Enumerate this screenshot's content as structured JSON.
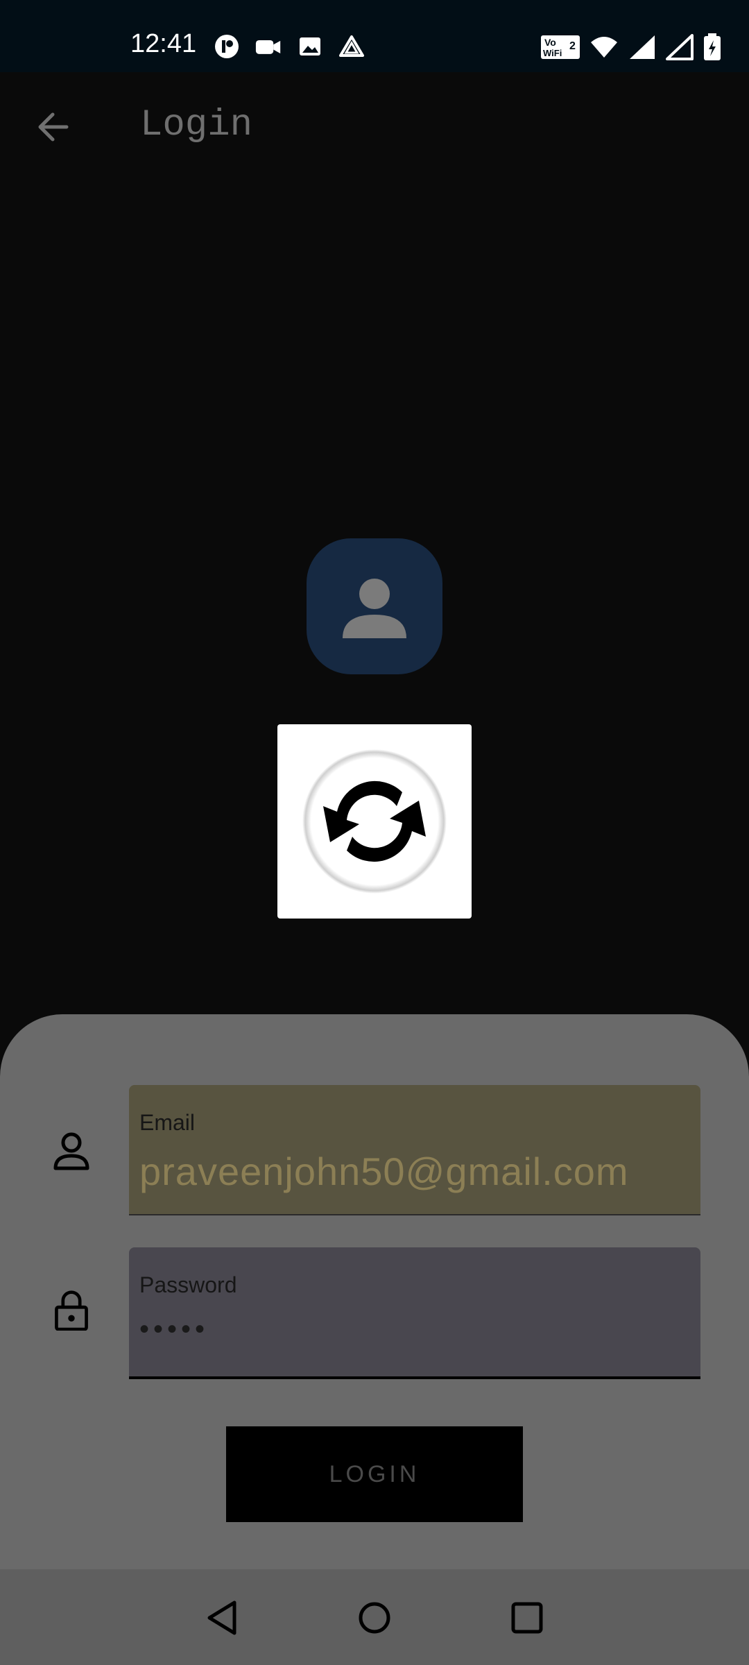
{
  "status_bar": {
    "time": "12:41",
    "left_icons": [
      "app-notification-icon",
      "video-camera-icon",
      "gallery-icon",
      "drive-icon"
    ],
    "right_icons": [
      "vowifi2-icon",
      "wifi-icon",
      "signal-icon",
      "signal-icon-2",
      "battery-charging-icon"
    ]
  },
  "app_bar": {
    "title": "Login",
    "back_icon": "arrow-left-icon"
  },
  "avatar": {
    "icon": "person-icon",
    "background": "#162942"
  },
  "loading": {
    "icon": "refresh-icon"
  },
  "form": {
    "email": {
      "label": "Email",
      "value": "praveenjohn50@gmail.com",
      "icon": "person-outline-icon"
    },
    "password": {
      "label": "Password",
      "value": "•••••",
      "icon": "lock-icon"
    },
    "login_button": "LOGIN"
  },
  "nav_bar": {
    "buttons": [
      "back-triangle-icon",
      "home-circle-icon",
      "recents-square-icon"
    ]
  },
  "colors": {
    "status_bar": "#020e16",
    "background": "#0a0a0a",
    "sheet": "#6a6a6a",
    "email_field": "#585440",
    "password_field": "#49474f"
  }
}
